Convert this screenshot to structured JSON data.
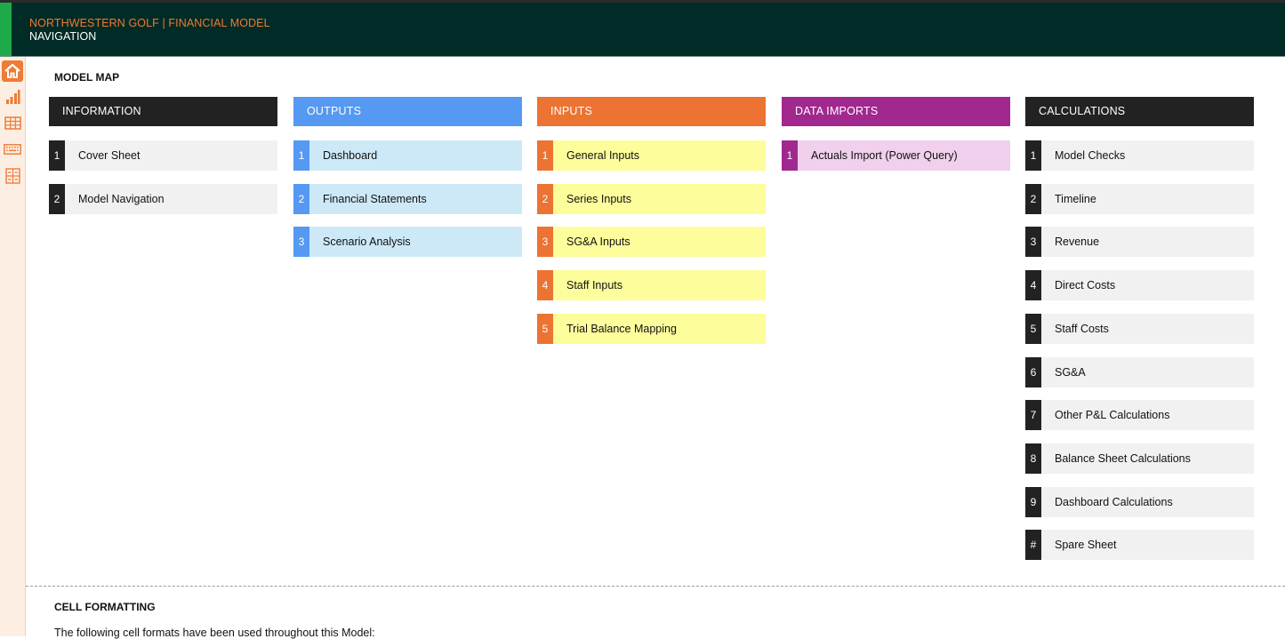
{
  "header": {
    "title": "NORTHWESTERN GOLF | FINANCIAL MODEL",
    "subtitle": "NAVIGATION"
  },
  "sidebar": {
    "icons": [
      "home-icon",
      "bar-chart-icon",
      "table-icon",
      "keyboard-icon",
      "layout-grid-icon"
    ]
  },
  "model_map": {
    "title": "MODEL MAP",
    "columns": [
      {
        "heading": "INFORMATION",
        "color": "#222222",
        "item_bg": "#f1f1f1",
        "items": [
          {
            "num": "1",
            "label": "Cover Sheet"
          },
          {
            "num": "2",
            "label": "Model Navigation"
          }
        ]
      },
      {
        "heading": "OUTPUTS",
        "color": "#5599f2",
        "item_bg": "#cde9f8",
        "items": [
          {
            "num": "1",
            "label": "Dashboard"
          },
          {
            "num": "2",
            "label": "Financial Statements"
          },
          {
            "num": "3",
            "label": "Scenario Analysis"
          }
        ]
      },
      {
        "heading": "INPUTS",
        "color": "#ec7332",
        "item_bg": "#fdfd9c",
        "items": [
          {
            "num": "1",
            "label": "General Inputs"
          },
          {
            "num": "2",
            "label": "Series Inputs"
          },
          {
            "num": "3",
            "label": "SG&A Inputs"
          },
          {
            "num": "4",
            "label": "Staff Inputs"
          },
          {
            "num": "5",
            "label": "Trial Balance Mapping"
          }
        ]
      },
      {
        "heading": "DATA IMPORTS",
        "color": "#a1288f",
        "item_bg": "#f0d0ec",
        "items": [
          {
            "num": "1",
            "label": "Actuals Import (Power Query)"
          }
        ]
      },
      {
        "heading": "CALCULATIONS",
        "color": "#222222",
        "item_bg": "#f1f1f1",
        "items": [
          {
            "num": "1",
            "label": "Model Checks"
          },
          {
            "num": "2",
            "label": "Timeline"
          },
          {
            "num": "3",
            "label": "Revenue"
          },
          {
            "num": "4",
            "label": "Direct Costs"
          },
          {
            "num": "5",
            "label": "Staff Costs"
          },
          {
            "num": "6",
            "label": "SG&A"
          },
          {
            "num": "7",
            "label": "Other P&L Calculations"
          },
          {
            "num": "8",
            "label": "Balance Sheet Calculations"
          },
          {
            "num": "9",
            "label": "Dashboard Calculations"
          },
          {
            "num": "#",
            "label": "Spare Sheet"
          }
        ]
      }
    ]
  },
  "cell_formatting": {
    "title": "CELL FORMATTING",
    "description": "The following cell formats have been used throughout this Model:"
  }
}
